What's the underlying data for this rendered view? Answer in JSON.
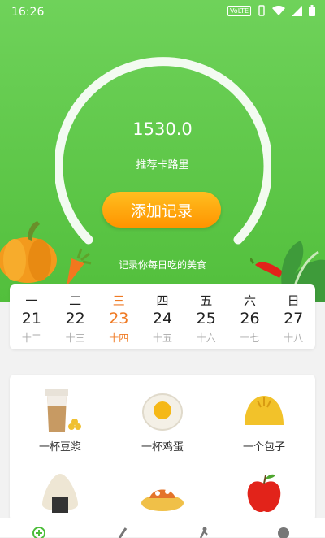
{
  "status_bar": {
    "time": "16:26",
    "network": "VoLTE"
  },
  "gauge": {
    "calories": "1530.0",
    "label": "推荐卡路里"
  },
  "add_button": {
    "label": "添加记录"
  },
  "slogan": "记录你每日吃的美食",
  "calendar": {
    "days": [
      {
        "weekday": "一",
        "date": "21",
        "lunar": "十二"
      },
      {
        "weekday": "二",
        "date": "22",
        "lunar": "十三"
      },
      {
        "weekday": "三",
        "date": "23",
        "lunar": "十四",
        "active": true
      },
      {
        "weekday": "四",
        "date": "24",
        "lunar": "十五"
      },
      {
        "weekday": "五",
        "date": "25",
        "lunar": "十六"
      },
      {
        "weekday": "六",
        "date": "26",
        "lunar": "十七"
      },
      {
        "weekday": "日",
        "date": "27",
        "lunar": "十八"
      }
    ]
  },
  "foods": [
    {
      "name": "一杯豆浆",
      "icon": "soy-milk-icon"
    },
    {
      "name": "一杯鸡蛋",
      "icon": "egg-icon"
    },
    {
      "name": "一个包子",
      "icon": "bun-icon"
    },
    {
      "name": "",
      "icon": "rice-ball-icon"
    },
    {
      "name": "",
      "icon": "dish-icon"
    },
    {
      "name": "",
      "icon": "apple-icon"
    }
  ],
  "bottom_nav": {
    "items": [
      "home-icon",
      "food-icon",
      "exercise-icon",
      "profile-icon"
    ]
  },
  "colors": {
    "header_green": "#5cc646",
    "accent_orange": "#ef7a24",
    "button_orange": "#ffa60f"
  }
}
